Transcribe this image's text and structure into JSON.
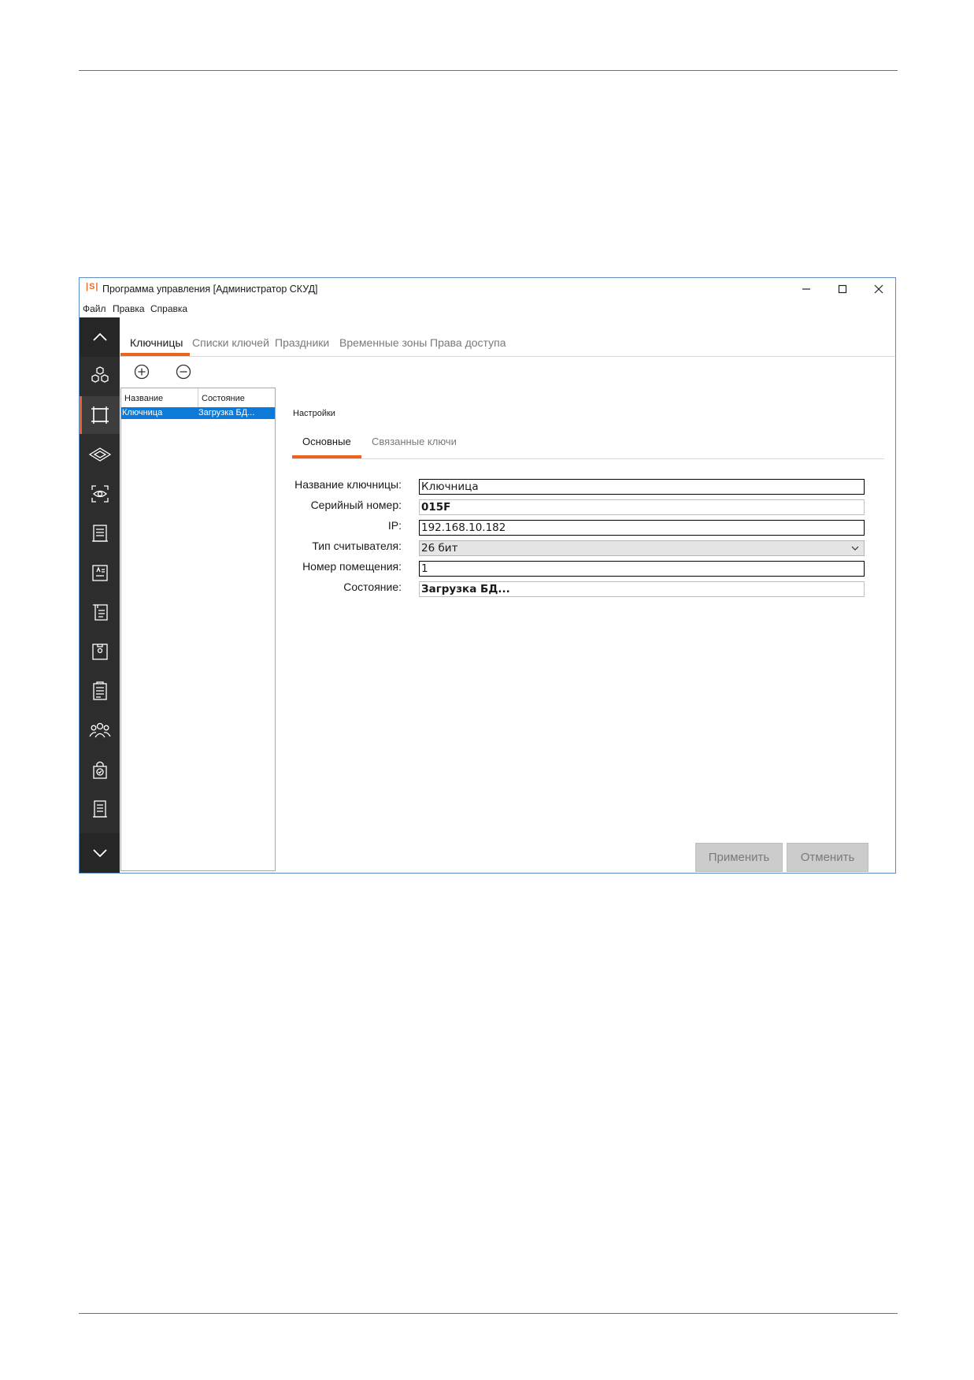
{
  "window": {
    "logo": "|S|",
    "title": "Программа управления [Администратор СКУД]"
  },
  "menu": [
    "Файл",
    "Правка",
    "Справка"
  ],
  "sidebar": {
    "items": [
      "dashboard-icon",
      "keybox-icon",
      "layers-icon",
      "face-scan-icon",
      "report-list-icon",
      "badge-icon",
      "document-icon",
      "archive-icon",
      "clipboard-icon",
      "users-icon",
      "lock-check-icon",
      "log-icon"
    ],
    "active_index": 1
  },
  "main_tabs": [
    "Ключницы",
    "Списки ключей",
    "Праздники",
    "Временные зоны",
    "Права доступа"
  ],
  "list": {
    "headers": [
      "Название",
      "Состояние"
    ],
    "rows": [
      {
        "name": "Ключница",
        "state": "Загрузка БД..."
      }
    ]
  },
  "settings": {
    "title": "Настройки",
    "tabs": [
      "Основные",
      "Связанные ключи"
    ],
    "fields": {
      "name_label": "Название ключницы:",
      "name_value": "Ключница",
      "serial_label": "Серийный номер:",
      "serial_value": "015F",
      "ip_label": "IP:",
      "ip_value": "192.168.10.182",
      "reader_label": "Тип считывателя:",
      "reader_value": "26 бит",
      "room_label": "Номер помещения:",
      "room_value": "1",
      "state_label": "Состояние:",
      "state_value": "Загрузка БД..."
    }
  },
  "buttons": {
    "apply": "Применить",
    "cancel": "Отменить"
  },
  "colors": {
    "accent": "#e8641f",
    "selection": "#0c7ad8",
    "sidebar": "#2d2d2d"
  }
}
